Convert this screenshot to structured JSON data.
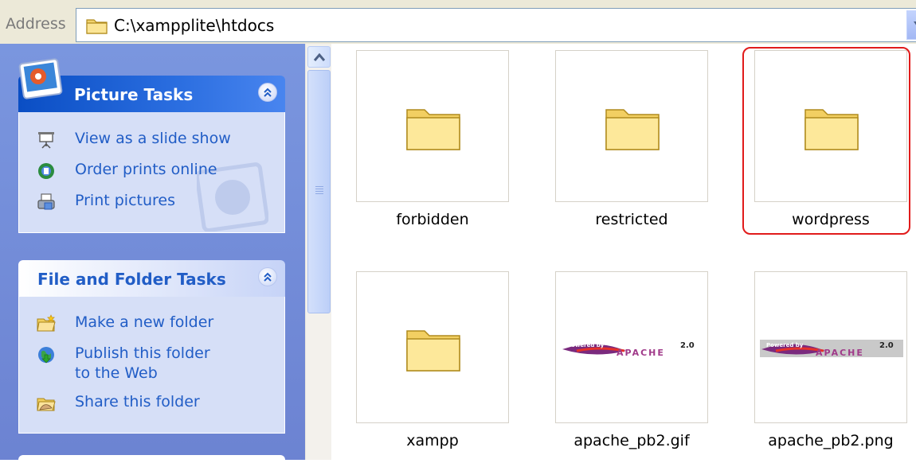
{
  "address": {
    "label": "Address",
    "path": "C:\\xampplite\\htdocs"
  },
  "task_pane": {
    "picture_tasks": {
      "title": "Picture Tasks",
      "items": [
        {
          "label": "View as a slide show",
          "icon": "slideshow-icon"
        },
        {
          "label": "Order prints online",
          "icon": "order-prints-icon"
        },
        {
          "label": "Print pictures",
          "icon": "print-icon"
        }
      ]
    },
    "file_folder_tasks": {
      "title": "File and Folder Tasks",
      "items": [
        {
          "label": "Make a new folder",
          "icon": "new-folder-icon"
        },
        {
          "label": "Publish this folder to the Web",
          "icon": "publish-web-icon"
        },
        {
          "label": "Share this folder",
          "icon": "share-folder-icon"
        }
      ]
    }
  },
  "files": [
    {
      "name": "forbidden",
      "type": "folder"
    },
    {
      "name": "restricted",
      "type": "folder"
    },
    {
      "name": "wordpress",
      "type": "folder",
      "selected": true
    },
    {
      "name": "xampp",
      "type": "folder"
    },
    {
      "name": "apache_pb2.gif",
      "type": "image"
    },
    {
      "name": "apache_pb2.png",
      "type": "image"
    }
  ],
  "apache_badge": {
    "powered": "Powered by",
    "brand": "APACHE",
    "version": "2.0"
  },
  "colors": {
    "selection_ring": "#e11b1b",
    "task_link": "#215dc6",
    "special_header": "#0a4ec4"
  }
}
